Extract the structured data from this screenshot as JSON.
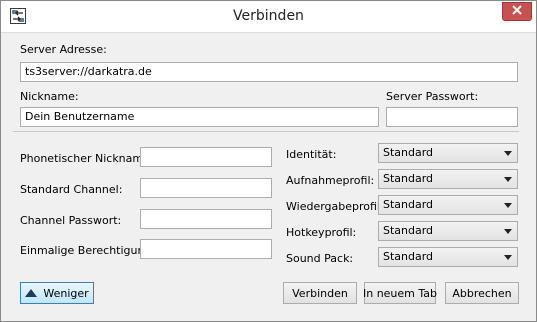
{
  "dialog": {
    "title": "Verbinden"
  },
  "server": {
    "address_label": "Server Adresse:",
    "address_value": "ts3server://darkatra.de",
    "nickname_label": "Nickname:",
    "nickname_value": "Dein Benutzername",
    "password_label": "Server Passwort:",
    "password_value": ""
  },
  "advanced": {
    "phonetic_label": "Phonetischer Nickname:",
    "phonetic_value": "",
    "channel_label": "Standard Channel:",
    "channel_value": "",
    "channel_password_label": "Channel Passwort:",
    "channel_password_value": "",
    "privilege_label": "Einmalige Berechtigung:",
    "privilege_value": ""
  },
  "profiles": {
    "identity_label": "Identität:",
    "identity_value": "Standard",
    "capture_label": "Aufnahmeprofil:",
    "capture_value": "Standard",
    "playback_label": "Wiedergabeprofil:",
    "playback_value": "Standard",
    "hotkey_label": "Hotkeyprofil:",
    "hotkey_value": "Standard",
    "soundpack_label": "Sound Pack:",
    "soundpack_value": "Standard"
  },
  "buttons": {
    "less_label": "Weniger",
    "connect_label": "Verbinden",
    "new_tab_label": "In neuem Tab",
    "cancel_label": "Abbrechen"
  },
  "icons": {
    "app": "teamspeak-connect-icon",
    "close": "close-icon",
    "less": "triangle-up-icon"
  },
  "colors": {
    "close_button": "#c75050",
    "less_button": "#bee6fd"
  }
}
